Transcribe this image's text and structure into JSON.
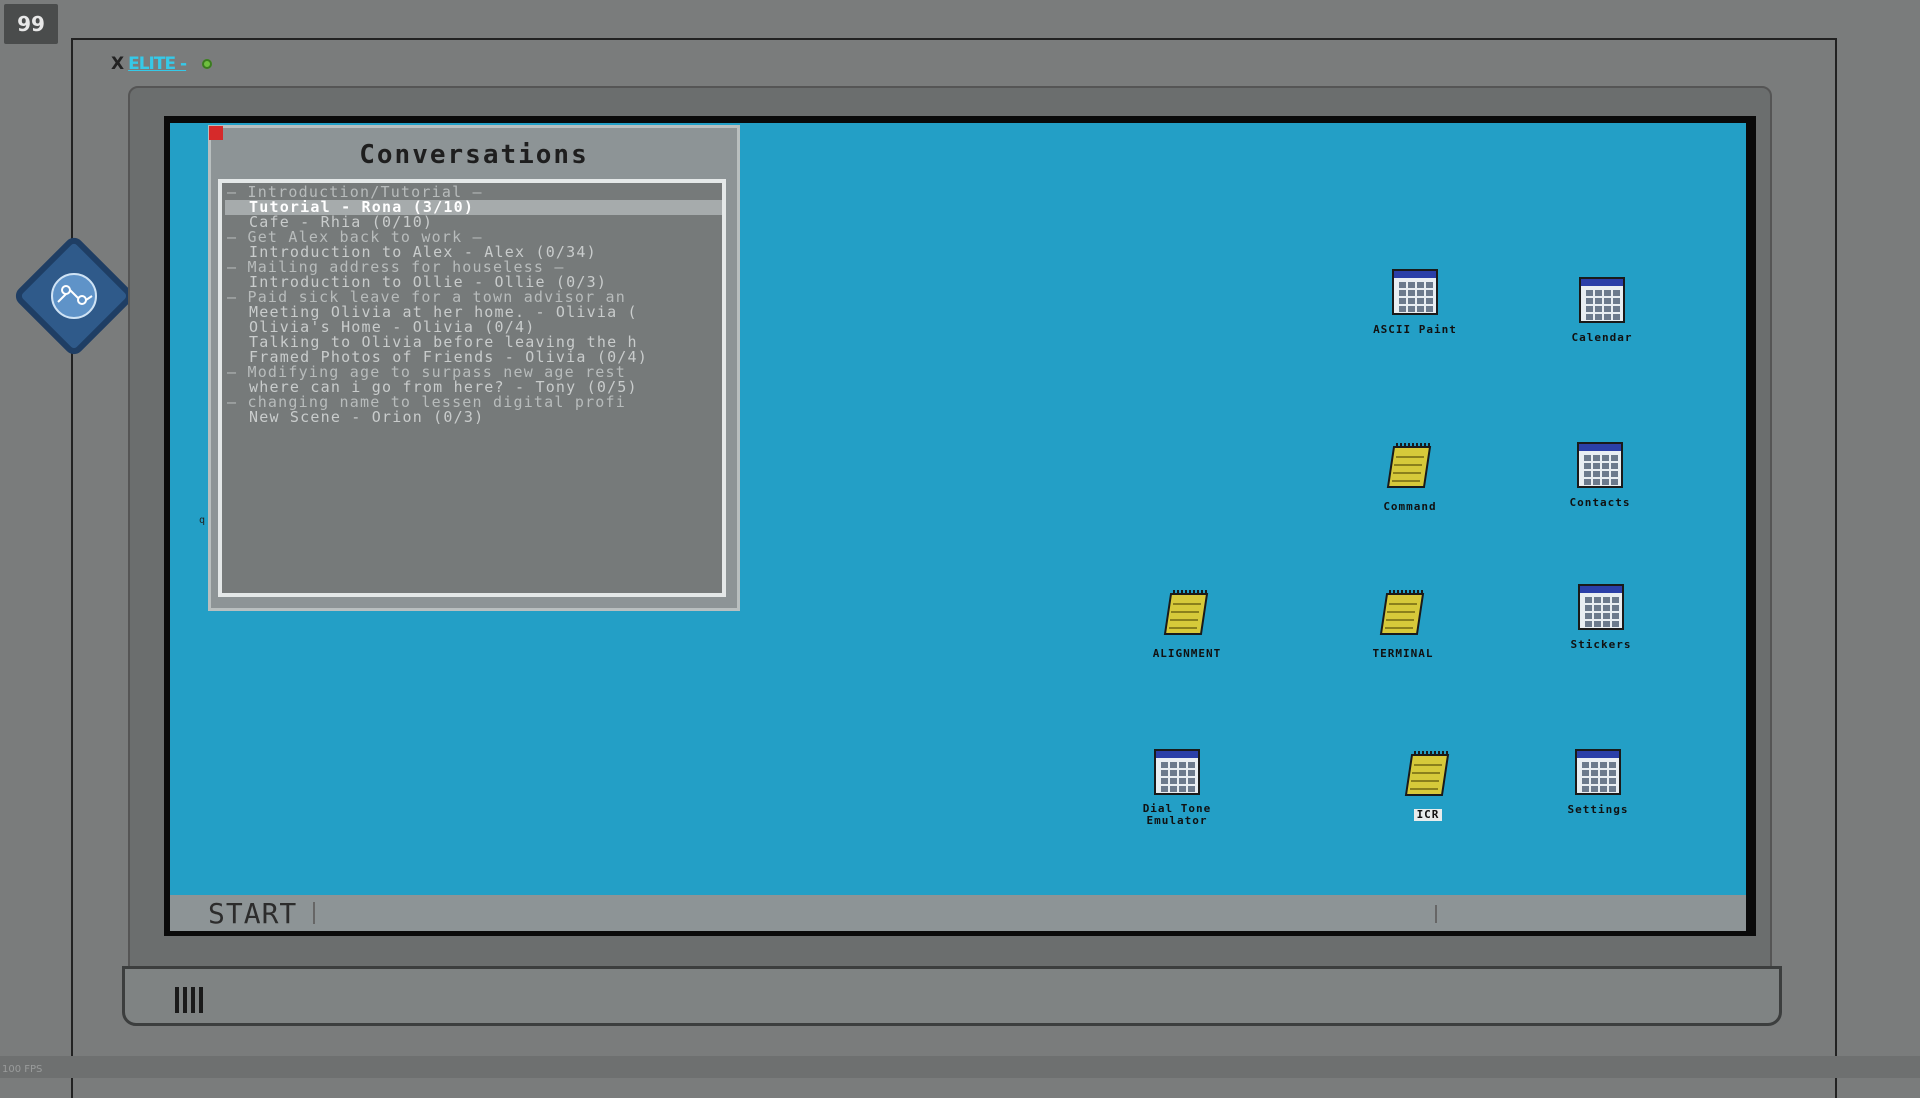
{
  "hud": {
    "counter": "99",
    "fps": "100 FPS"
  },
  "brand": {
    "prefix": "X",
    "name": "ELITE -"
  },
  "conversations": {
    "title": "Conversations",
    "items": [
      {
        "text": "— Introduction/Tutorial —",
        "header": true
      },
      {
        "text": "Tutorial - Rona (3/10)",
        "selected": true
      },
      {
        "text": "Cafe - Rhia (0/10)"
      },
      {
        "text": "— Get Alex back to work —",
        "header": true
      },
      {
        "text": "Introduction to Alex - Alex (0/34)"
      },
      {
        "text": "— Mailing address for houseless —",
        "header": true
      },
      {
        "text": "Introduction to Ollie - Ollie (0/3)"
      },
      {
        "text": "— Paid sick leave for a town advisor an",
        "header": true
      },
      {
        "text": "Meeting Olivia at her home. - Olivia ("
      },
      {
        "text": "Olivia's Home - Olivia (0/4)"
      },
      {
        "text": "Talking to Olivia before leaving the h"
      },
      {
        "text": "Framed Photos of Friends - Olivia (0/4)"
      },
      {
        "text": "— Modifying age to surpass new age rest",
        "header": true
      },
      {
        "text": "where can i go from here? - Tony (0/5)"
      },
      {
        "text": "— changing name to lessen digital profi",
        "header": true
      },
      {
        "text": "New Scene - Orion (0/3)"
      }
    ],
    "stray": "q"
  },
  "desktop_icons": [
    {
      "label": "ASCII Paint",
      "kind": "window",
      "name": "ascii-paint-icon"
    },
    {
      "label": "Calendar",
      "kind": "window",
      "name": "calendar-icon"
    },
    {
      "label": "Command",
      "kind": "notepad",
      "name": "command-icon"
    },
    {
      "label": "Contacts",
      "kind": "window",
      "name": "contacts-icon"
    },
    {
      "label": "ALIGNMENT",
      "kind": "notepad",
      "name": "alignment-icon"
    },
    {
      "label": "TERMINAL",
      "kind": "notepad",
      "name": "terminal-icon"
    },
    {
      "label": "Stickers",
      "kind": "window",
      "name": "stickers-icon"
    },
    {
      "label": "Dial Tone Emulator",
      "kind": "window",
      "name": "dial-tone-emulator-icon"
    },
    {
      "label": "ICR",
      "kind": "notepad",
      "name": "icr-icon",
      "selected": true
    },
    {
      "label": "Settings",
      "kind": "window",
      "name": "settings-icon"
    }
  ],
  "taskbar": {
    "start_label": "START"
  },
  "colors": {
    "desktop": "#239fc6",
    "window": "#8d9496",
    "close": "#d62a2a",
    "brand": "#36c9e8"
  }
}
